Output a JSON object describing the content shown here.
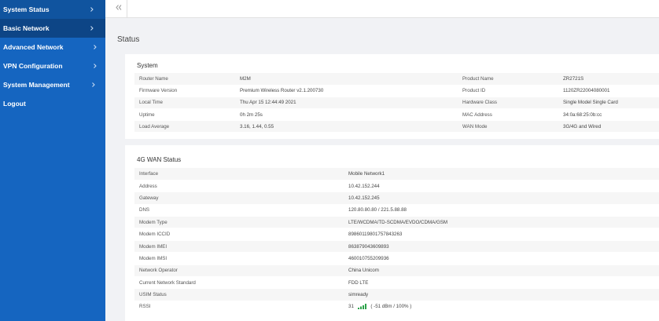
{
  "sidebar": {
    "items": [
      {
        "label": "System Status"
      },
      {
        "label": "Basic Network"
      },
      {
        "label": "Advanced Network"
      },
      {
        "label": "VPN Configuration"
      },
      {
        "label": "System Management"
      },
      {
        "label": "Logout"
      }
    ]
  },
  "page": {
    "title": "Status"
  },
  "system": {
    "title": "System",
    "rows": [
      {
        "l1": "Router Name",
        "v1": "M2M",
        "l2": "Product Name",
        "v2": "ZR2721S"
      },
      {
        "l1": "Firmware Version",
        "v1": "Premium Wireless Router v2.1.200730",
        "l2": "Product ID",
        "v2": "1120ZR22004080001"
      },
      {
        "l1": "Local Time",
        "v1": "Thu Apr 15 12:44:49 2021",
        "l2": "Hardware Class",
        "v2": "Single Model Single Card"
      },
      {
        "l1": "Uptime",
        "v1": "0h 2m 25s",
        "l2": "MAC Address",
        "v2": "34:0a:68:25:0b:cc"
      },
      {
        "l1": "Load Average",
        "v1": "3.16, 1.44, 0.55",
        "l2": "WAN Mode",
        "v2": "3G/4G and Wired"
      }
    ]
  },
  "wan": {
    "title": "4G WAN Status",
    "rows": [
      {
        "label": "Interface",
        "value": "Mobile Network1"
      },
      {
        "label": "Address",
        "value": "10.42.152.244"
      },
      {
        "label": "Gateway",
        "value": "10.42.152.245"
      },
      {
        "label": "DNS",
        "value": "120.80.80.80 / 221.5.88.88"
      },
      {
        "label": "Modem Type",
        "value": "LTE/WCDMA/TD-SCDMA/EVDO/CDMA/GSM"
      },
      {
        "label": "Modem ICCID",
        "value": "89860119801757843263"
      },
      {
        "label": "Modem IMEI",
        "value": "863879043609893"
      },
      {
        "label": "Modem IMSI",
        "value": "460010755209936"
      },
      {
        "label": "Network Operator",
        "value": "China Unicom"
      },
      {
        "label": "Current Network Standard",
        "value": "FDD LTE"
      },
      {
        "label": "USIM Status",
        "value": "simready"
      }
    ],
    "rssi": {
      "label": "RSSI",
      "value": "31",
      "detail": "( -51 dBm / 100% )",
      "signal_icon": "signal-strength-icon"
    }
  },
  "colors": {
    "sidebar": "#1565c0",
    "sidebar_selected": "#0d4586",
    "background": "#f1f2f5",
    "signal_green": "#2ca24a"
  }
}
